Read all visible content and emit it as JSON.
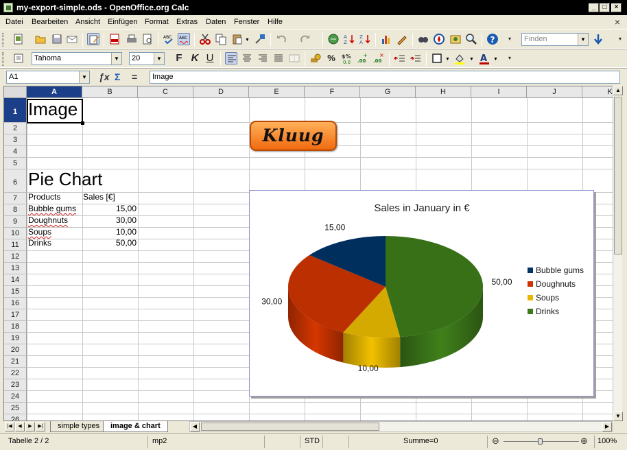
{
  "window": {
    "title": "my-export-simple.ods - OpenOffice.org Calc"
  },
  "menu": {
    "items": [
      "Datei",
      "Bearbeiten",
      "Ansicht",
      "Einfügen",
      "Format",
      "Extras",
      "Daten",
      "Fenster",
      "Hilfe"
    ]
  },
  "toolbar": {
    "find_placeholder": "Finden",
    "font_name": "Tahoma",
    "font_size": "20",
    "bold": "F",
    "italic": "K",
    "underline": "U"
  },
  "formula_bar": {
    "cell_ref": "A1",
    "content": "Image"
  },
  "columns": [
    "A",
    "B",
    "C",
    "D",
    "E",
    "F",
    "G",
    "H",
    "I",
    "J",
    "K"
  ],
  "rows": [
    "1",
    "2",
    "3",
    "4",
    "5",
    "6",
    "7",
    "8",
    "9",
    "10",
    "11",
    "12",
    "13",
    "14",
    "15",
    "16",
    "17",
    "18",
    "19",
    "20",
    "21",
    "22",
    "23",
    "24",
    "25",
    "26"
  ],
  "cells": {
    "a1": "Image",
    "a6": "Pie Chart",
    "a7": "Products",
    "b7": "Sales [€]",
    "a8": "Bubble gums",
    "b8": "15,00",
    "a9": "Doughnuts",
    "b9": "30,00",
    "a10": "Soups",
    "b10": "10,00",
    "a11": "Drinks",
    "b11": "50,00"
  },
  "logo": {
    "text": "Kluug"
  },
  "chart_data": {
    "type": "pie",
    "title": "Sales in January in €",
    "categories": [
      "Bubble gums",
      "Doughnuts",
      "Soups",
      "Drinks"
    ],
    "values": [
      15,
      30,
      10,
      50
    ],
    "data_labels": [
      "15,00",
      "30,00",
      "10,00",
      "50,00"
    ],
    "colors": [
      "#003366",
      "#cc3300",
      "#e6b800",
      "#3d7a1a"
    ],
    "legend": "right",
    "style": "3d"
  },
  "sheet_tabs": [
    "simple types",
    "image & chart"
  ],
  "active_tab": "image & chart",
  "status": {
    "sheet": "Tabelle 2 / 2",
    "style": "mp2",
    "mode": "STD",
    "sum": "Summe=0",
    "zoom": "100%"
  }
}
